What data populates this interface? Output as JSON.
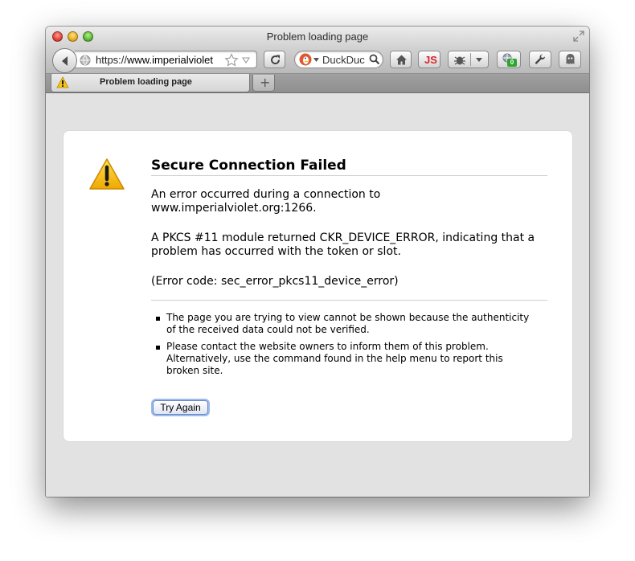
{
  "window": {
    "title": "Problem loading page"
  },
  "toolbar": {
    "url_scheme": "https://",
    "url_host": "www.imperialviolet",
    "search_placeholder": "DuckDuc",
    "js_label": "JS",
    "badge_count": "0"
  },
  "tabs": [
    {
      "label": "Problem loading page"
    }
  ],
  "error": {
    "title": "Secure Connection Failed",
    "p1_line1": "An error occurred during a connection to",
    "p1_line2": "www.imperialviolet.org:1266.",
    "p2_line1": "A PKCS #11 module returned CKR_DEVICE_ERROR, indicating that a",
    "p2_line2": "problem has occurred with the token or slot.",
    "code": "(Error code: sec_error_pkcs11_device_error)",
    "bullet1_line1": "The page you are trying to view cannot be shown because the authenticity",
    "bullet1_line2": "of the received data could not be verified.",
    "bullet2_line1": "Please contact the website owners to inform them of this problem.",
    "bullet2_line2": "Alternatively, use the command found in the help menu to report this",
    "bullet2_line3": "broken site.",
    "try_again_label": "Try Again"
  },
  "colors": {
    "warning_yellow": "#f6c21a",
    "js_red": "#d8242a",
    "badge_green": "#2ca52c",
    "focus_ring": "#9cbcee"
  },
  "icons": [
    "fullscreen-icon",
    "back-icon",
    "globe-icon",
    "star-icon",
    "dropmarker-icon",
    "reload-icon",
    "duckduckgo-icon",
    "magnifier-icon",
    "home-icon",
    "bug-icon",
    "chevron-down-icon",
    "extension-icon",
    "wrench-icon",
    "ghost-icon",
    "warning-icon",
    "plus-icon"
  ]
}
